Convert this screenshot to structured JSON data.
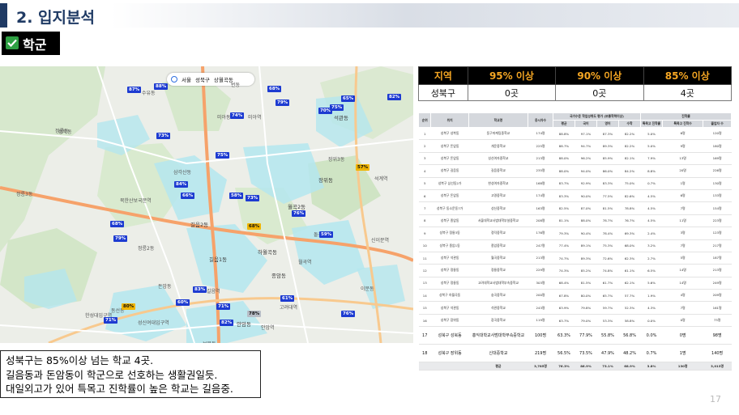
{
  "header": {
    "title": "2. 입지분석",
    "subtitle": "학군"
  },
  "map": {
    "toolbar": [
      "서울",
      "성북구",
      "상월곡동"
    ],
    "places": [
      [
        "정릉동",
        68,
        157,
        ""
      ],
      [
        "성북동",
        72,
        158,
        ""
      ],
      [
        "돈암동",
        195,
        349,
        ""
      ],
      [
        "북한산보국문역",
        148,
        243,
        ""
      ],
      [
        "길음2동",
        235,
        272,
        "b"
      ],
      [
        "길음1동",
        258,
        315,
        "b"
      ],
      [
        "월곡2동",
        355,
        250,
        "b"
      ],
      [
        "석관동",
        412,
        140,
        "b"
      ],
      [
        "종암동",
        335,
        335,
        "b"
      ],
      [
        "안암동",
        292,
        395,
        "b"
      ],
      [
        "하월곡동",
        318,
        306,
        "b"
      ],
      [
        "장위동",
        393,
        217,
        "b"
      ],
      [
        "삼각산동",
        214,
        208,
        ""
      ],
      [
        "미아동",
        268,
        140,
        ""
      ],
      [
        "번동",
        285,
        100,
        ""
      ],
      [
        "성신여대입구역",
        170,
        394,
        ""
      ],
      [
        "보문동",
        250,
        420,
        ""
      ],
      [
        "수유동",
        175,
        110,
        ""
      ],
      [
        "정릉3동",
        20,
        235,
        ""
      ],
      [
        "정릉2동",
        170,
        302,
        ""
      ],
      [
        "미아역",
        306,
        140,
        ""
      ],
      [
        "길음역",
        255,
        355,
        ""
      ],
      [
        "월곡역",
        368,
        319,
        ""
      ],
      [
        "돌곶이역",
        387,
        285,
        ""
      ],
      [
        "고려대역",
        345,
        375,
        ""
      ],
      [
        "한성대입구역",
        105,
        385,
        ""
      ],
      [
        "동선동",
        137,
        379,
        ""
      ],
      [
        "장위3동",
        405,
        192,
        ""
      ],
      [
        "안암역",
        322,
        400,
        ""
      ],
      [
        "이문동",
        445,
        352,
        ""
      ],
      [
        "석계역",
        462,
        216,
        ""
      ],
      [
        "신이문역",
        458,
        292,
        ""
      ]
    ],
    "pins": [
      [
        "87%",
        157,
        109,
        "blue",
        ""
      ],
      [
        "68%",
        330,
        108,
        "blue",
        ""
      ],
      [
        "88%",
        190,
        105,
        "blue",
        ""
      ],
      [
        "79%",
        340,
        125,
        "blue",
        ""
      ],
      [
        "74%",
        284,
        141,
        "blue",
        ""
      ],
      [
        "70%",
        393,
        135,
        "blue",
        ""
      ],
      [
        "75%",
        407,
        131,
        "blue",
        ""
      ],
      [
        "65%",
        421,
        120,
        "blue",
        ""
      ],
      [
        "82%",
        478,
        118,
        "blue",
        ""
      ],
      [
        "73%",
        193,
        166,
        "blue",
        ""
      ],
      [
        "75%",
        266,
        190,
        "blue",
        ""
      ],
      [
        "57%",
        439,
        205,
        "yellow",
        ""
      ],
      [
        "84%",
        215,
        226,
        "blue",
        ""
      ],
      [
        "66%",
        223,
        240,
        "blue",
        ""
      ],
      [
        "58%",
        283,
        240,
        "blue",
        ""
      ],
      [
        "73%",
        303,
        243,
        "blue",
        ""
      ],
      [
        "76%",
        360,
        262,
        "blue",
        ""
      ],
      [
        "59%",
        394,
        288,
        "blue",
        ""
      ],
      [
        "68%",
        136,
        275,
        "blue",
        ""
      ],
      [
        "79%",
        140,
        293,
        "blue",
        ""
      ],
      [
        "68%",
        305,
        278,
        "yellow",
        ""
      ],
      [
        "83%",
        238,
        356,
        "blue",
        ""
      ],
      [
        "60%",
        217,
        372,
        "blue",
        ""
      ],
      [
        "71%",
        267,
        377,
        "blue",
        ""
      ],
      [
        "61%",
        346,
        367,
        "blue",
        ""
      ],
      [
        "80%",
        150,
        377,
        "yellow",
        ""
      ],
      [
        "71%",
        128,
        394,
        "blue",
        ""
      ],
      [
        "78%",
        305,
        386,
        "gray",
        ""
      ],
      [
        "76%",
        421,
        386,
        "blue",
        ""
      ],
      [
        "82%",
        271,
        397,
        "blue",
        ""
      ]
    ]
  },
  "caption": {
    "lines": [
      "성북구는 85%이상 넘는 학교 4곳.",
      "길음동과 돈암동이 학군으로 선호하는 생활권일듯.",
      "대일외고가 있어 특목고 진학률이 높은 학교는 길음중."
    ]
  },
  "summary_table": {
    "headers": [
      "지역",
      "95% 이상",
      "90% 이상",
      "85% 이상"
    ],
    "row": [
      "성북구",
      "0곳",
      "0곳",
      "4곳"
    ]
  },
  "detail_table": {
    "header_group_1": "국가수준 학업성취도 평가 (보통학력이상)",
    "header_group_2": "진학률",
    "headers": [
      "순위",
      "위치",
      "학교명",
      "응시자수",
      "평균",
      "국어",
      "영어",
      "수학",
      "특목고 진학률",
      "특목고 진학수",
      "졸업자 수"
    ],
    "rows": [
      [
        "1",
        "성북구 성북동",
        "동구마케팅중학교",
        "174명",
        "88.8%",
        "97.1%",
        "87.3%",
        "82.2%",
        "5.0%",
        "6명",
        "120명"
      ],
      [
        "2",
        "성북구 돈암동",
        "개운중학교",
        "225명",
        "88.7%",
        "94.7%",
        "89.3%",
        "82.2%",
        "5.0%",
        "9명",
        "180명"
      ],
      [
        "3",
        "성북구 돈암동",
        "성신여자중학교",
        "213명",
        "88.0%",
        "96.2%",
        "85.9%",
        "82.1%",
        "7.9%",
        "13명",
        "169명"
      ],
      [
        "4",
        "성북구 길음동",
        "길음중학교",
        "235명",
        "88.0%",
        "94.0%",
        "86.0%",
        "84.2%",
        "8.8%",
        "20명",
        "226명"
      ],
      [
        "5",
        "성북구 삼선동2가",
        "한성여자중학교",
        "168명",
        "83.7%",
        "92.9%",
        "83.3%",
        "75.0%",
        "0.7%",
        "1명",
        "130명"
      ],
      [
        "6",
        "성북구 돈암동",
        "고명중학교",
        "174명",
        "83.3%",
        "90.0%",
        "77.5%",
        "82.6%",
        "4.5%",
        "6명",
        "133명"
      ],
      [
        "7",
        "성북구 동소문동7가",
        "성신중학교",
        "163명",
        "82.5%",
        "87.0%",
        "81.5%",
        "78.8%",
        "4.5%",
        "7명",
        "154명"
      ],
      [
        "8",
        "성북구 종암동",
        "서울대학교사범대학부설중학교",
        "208명",
        "81.1%",
        "88.0%",
        "78.7%",
        "76.7%",
        "4.5%",
        "11명",
        "223명"
      ],
      [
        "9",
        "성북구 정릉3동",
        "정덕중학교",
        "176명",
        "79.3%",
        "90.4%",
        "78.4%",
        "69.3%",
        "2.4%",
        "3명",
        "123명"
      ],
      [
        "10",
        "성북구 종암1동",
        "종암중학교",
        "247명",
        "77.4%",
        "89.1%",
        "75.3%",
        "68.0%",
        "3.2%",
        "7명",
        "217명"
      ],
      [
        "11",
        "성북구 석관동",
        "월곡중학교",
        "213명",
        "74.7%",
        "89.3%",
        "72.6%",
        "62.3%",
        "2.7%",
        "5명",
        "187명"
      ],
      [
        "12",
        "성북구 정릉동",
        "정릉중학교",
        "229명",
        "74.3%",
        "85.2%",
        "74.8%",
        "61.1%",
        "6.5%",
        "14명",
        "213명"
      ],
      [
        "13",
        "성북구 정릉동",
        "고려대학교사범대학부속중학교",
        "303명",
        "68.4%",
        "81.5%",
        "61.7%",
        "62.1%",
        "5.6%",
        "14명",
        "249명"
      ],
      [
        "14",
        "성북구 하월곡동",
        "숭곡중학교",
        "200명",
        "67.8%",
        "80.0%",
        "65.7%",
        "57.7%",
        "1.9%",
        "4명",
        "209명"
      ],
      [
        "15",
        "성북구 석관동",
        "석관중학교",
        "243명",
        "63.9%",
        "79.8%",
        "59.7%",
        "52.3%",
        "4.3%",
        "7명",
        "161명"
      ],
      [
        "16",
        "성북구 장위동",
        "장곡중학교",
        "119명",
        "63.7%",
        "79.0%",
        "53.3%",
        "58.8%",
        "0.0%",
        "0명",
        "73명"
      ],
      [
        "17",
        "성북구 성북동",
        "홍익대학교사범대학부속중학교",
        "100명",
        "63.3%",
        "77.9%",
        "55.8%",
        "56.8%",
        "0.0%",
        "0명",
        "98명"
      ],
      [
        "18",
        "성북구 장위동",
        "신대중학교",
        "219명",
        "56.5%",
        "73.5%",
        "47.9%",
        "48.2%",
        "0.7%",
        "1명",
        "140명"
      ]
    ],
    "avg_row": [
      "",
      "",
      "평균",
      "3,785명",
      "76.3%",
      "86.9%",
      "73.1%",
      "68.9%",
      "3.8%",
      "130명",
      "3,013명"
    ]
  },
  "page_number": "17",
  "colors": {
    "title": "#1f3a64",
    "pin": "#1d3bd1",
    "header_text": "#f5a623",
    "map_zone": "#b4e6ee"
  }
}
